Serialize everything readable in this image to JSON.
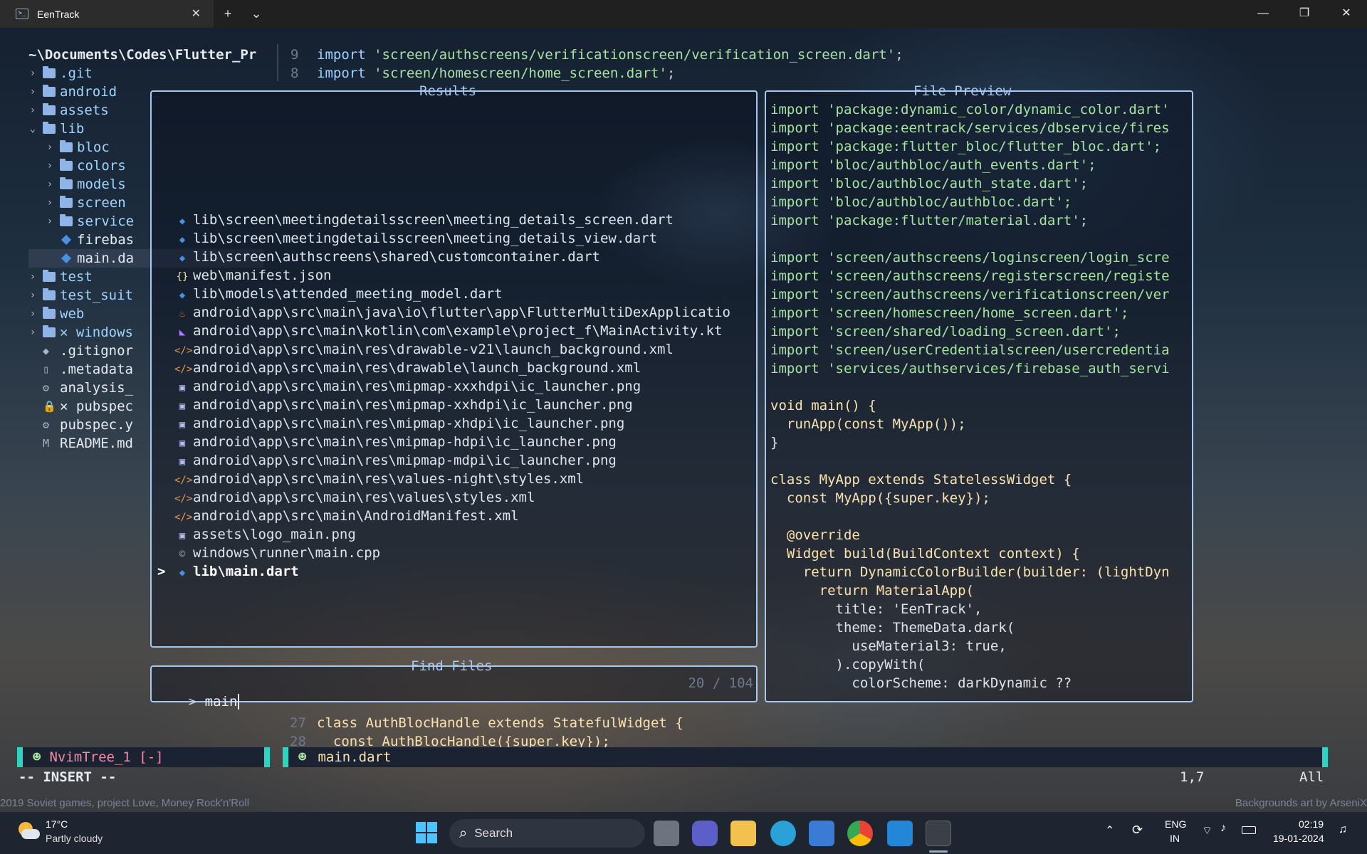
{
  "window": {
    "tab_title": "EenTrack",
    "new_tab": "+",
    "dropdown": "⌄",
    "minimize": "—",
    "restore": "❐",
    "close": "✕"
  },
  "editor_top": [
    {
      "num": "9",
      "code_kw": "import",
      "code_str": "'screen/authscreens/verificationscreen/verification_screen.dart'",
      "code_end": ";"
    },
    {
      "num": "8",
      "code_kw": "import",
      "code_str": "'screen/homescreen/home_screen.dart'",
      "code_end": ";"
    }
  ],
  "tree": {
    "path": "~\\Documents\\Codes\\Flutter_Pr",
    "items": [
      {
        "chev": "›",
        "type": "folder",
        "name": ".git"
      },
      {
        "chev": "›",
        "type": "folder",
        "name": "android"
      },
      {
        "chev": "›",
        "type": "folder",
        "name": "assets"
      },
      {
        "chev": "⌄",
        "type": "folder",
        "name": "lib"
      },
      {
        "chev": "›",
        "type": "folder",
        "name": "bloc",
        "indent": 1
      },
      {
        "chev": "›",
        "type": "folder",
        "name": "colors",
        "indent": 1
      },
      {
        "chev": "›",
        "type": "folder",
        "name": "models",
        "indent": 1
      },
      {
        "chev": "›",
        "type": "folder",
        "name": "screen",
        "indent": 1
      },
      {
        "chev": "›",
        "type": "folder",
        "name": "service",
        "indent": 1
      },
      {
        "chev": "",
        "type": "dart",
        "name": "firebas",
        "indent": 1
      },
      {
        "chev": "",
        "type": "dart",
        "name": "main.da",
        "indent": 1,
        "selected": true
      },
      {
        "chev": "›",
        "type": "folder",
        "name": "test"
      },
      {
        "chev": "›",
        "type": "folder",
        "name": "test_suit"
      },
      {
        "chev": "›",
        "type": "folder",
        "name": "web"
      },
      {
        "chev": "›",
        "type": "folder",
        "name": "✕ windows"
      },
      {
        "chev": "",
        "type": "git",
        "name": ".gitignor"
      },
      {
        "chev": "",
        "type": "file",
        "name": ".metadata"
      },
      {
        "chev": "",
        "type": "gear",
        "name": "analysis_"
      },
      {
        "chev": "",
        "type": "lock",
        "name": "✕ pubspec"
      },
      {
        "chev": "",
        "type": "gear",
        "name": "pubspec.y"
      },
      {
        "chev": "",
        "type": "md",
        "name": "README.md"
      }
    ]
  },
  "results": {
    "title": "Results",
    "items": [
      {
        "icon": "dart",
        "text": "lib\\screen\\meetingdetailsscreen\\meeting_details_screen.dart"
      },
      {
        "icon": "dart",
        "text": "lib\\screen\\meetingdetailsscreen\\meeting_details_view.dart"
      },
      {
        "icon": "dart",
        "text": "lib\\screen\\authscreens\\shared\\customcontainer.dart"
      },
      {
        "icon": "json",
        "text": "web\\manifest.json"
      },
      {
        "icon": "dart",
        "text": "lib\\models\\attended_meeting_model.dart"
      },
      {
        "icon": "java",
        "text": "android\\app\\src\\main\\java\\io\\flutter\\app\\FlutterMultiDexApplicatio"
      },
      {
        "icon": "kotlin",
        "text": "android\\app\\src\\main\\kotlin\\com\\example\\project_f\\MainActivity.kt"
      },
      {
        "icon": "xml",
        "text": "android\\app\\src\\main\\res\\drawable-v21\\launch_background.xml"
      },
      {
        "icon": "xml",
        "text": "android\\app\\src\\main\\res\\drawable\\launch_background.xml"
      },
      {
        "icon": "png",
        "text": "android\\app\\src\\main\\res\\mipmap-xxxhdpi\\ic_launcher.png"
      },
      {
        "icon": "png",
        "text": "android\\app\\src\\main\\res\\mipmap-xxhdpi\\ic_launcher.png"
      },
      {
        "icon": "png",
        "text": "android\\app\\src\\main\\res\\mipmap-xhdpi\\ic_launcher.png"
      },
      {
        "icon": "png",
        "text": "android\\app\\src\\main\\res\\mipmap-hdpi\\ic_launcher.png"
      },
      {
        "icon": "png",
        "text": "android\\app\\src\\main\\res\\mipmap-mdpi\\ic_launcher.png"
      },
      {
        "icon": "xml",
        "text": "android\\app\\src\\main\\res\\values-night\\styles.xml"
      },
      {
        "icon": "xml",
        "text": "android\\app\\src\\main\\res\\values\\styles.xml"
      },
      {
        "icon": "xml",
        "text": "android\\app\\src\\main\\AndroidManifest.xml"
      },
      {
        "icon": "png",
        "text": "assets\\logo_main.png"
      },
      {
        "icon": "cpp",
        "text": "windows\\runner\\main.cpp"
      },
      {
        "icon": "dart",
        "text": "lib\\main.dart",
        "selected": true
      }
    ],
    "selected_marker": ">"
  },
  "find": {
    "title": "Find Files",
    "prompt": ">",
    "query": "main",
    "count": "20 / 104"
  },
  "preview": {
    "title": "File Preview",
    "lines": [
      "import 'package:dynamic_color/dynamic_color.dart'",
      "import 'package:eentrack/services/dbservice/fires",
      "import 'package:flutter_bloc/flutter_bloc.dart';",
      "import 'bloc/authbloc/auth_events.dart';",
      "import 'bloc/authbloc/auth_state.dart';",
      "import 'bloc/authbloc/authbloc.dart';",
      "import 'package:flutter/material.dart';",
      "",
      "import 'screen/authscreens/loginscreen/login_scre",
      "import 'screen/authscreens/registerscreen/registe",
      "import 'screen/authscreens/verificationscreen/ver",
      "import 'screen/homescreen/home_screen.dart';",
      "import 'screen/shared/loading_screen.dart';",
      "import 'screen/userCredentialscreen/usercredentia",
      "import 'services/authservices/firebase_auth_servi",
      "",
      "void main() {",
      "  runApp(const MyApp());",
      "}",
      "",
      "class MyApp extends StatelessWidget {",
      "  const MyApp({super.key});",
      "",
      "  @override",
      "  Widget build(BuildContext context) {",
      "    return DynamicColorBuilder(builder: (lightDyn",
      "      return MaterialApp(",
      "        title: 'EenTrack',",
      "        theme: ThemeData.dark(",
      "          useMaterial3: true,",
      "        ).copyWith(",
      "          colorScheme: darkDynamic ??"
    ]
  },
  "editor_bottom": [
    {
      "num": "27",
      "code": "class AuthBlocHandle extends StatefulWidget {"
    },
    {
      "num": "28",
      "code": "  const AuthBlocHandle({super.key});"
    }
  ],
  "statusline": {
    "left": "NvimTree_1 [-]",
    "right": "main.dart",
    "mode": "-- INSERT --",
    "pos": "1,7",
    "scroll": "All"
  },
  "wallpaper": {
    "left_caption": "2019 Soviet games, project Love, Money Rock'n'Roll",
    "right_caption": "Backgrounds art by ArseniX"
  },
  "taskbar": {
    "temp": "17°C",
    "weather": "Partly cloudy",
    "search": "Search",
    "lang1": "ENG",
    "lang2": "IN",
    "time": "02:19",
    "date": "19-01-2024"
  },
  "colors": {
    "accent": "#a6c8ee",
    "mode_bg": "#1b2333"
  }
}
